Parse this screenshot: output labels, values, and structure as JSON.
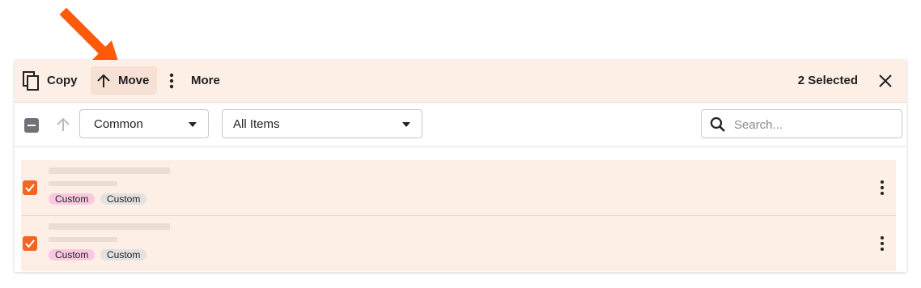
{
  "callout": {
    "icon": "orange-arrow-icon",
    "color": "#ff5a0a"
  },
  "action_bar": {
    "copy_label": "Copy",
    "move_label": "Move",
    "more_label": "More",
    "selected_text": "2 Selected",
    "icons": [
      "copy-icon",
      "arrow-up-icon",
      "more-vertical-icon",
      "close-icon"
    ]
  },
  "filters": {
    "category_select": "Common",
    "type_select": "All Items",
    "search_placeholder": "Search..."
  },
  "rows": [
    {
      "checked": true,
      "tags": [
        "Custom",
        "Custom"
      ]
    },
    {
      "checked": true,
      "tags": [
        "Custom",
        "Custom"
      ]
    }
  ],
  "colors": {
    "accent": "#f26522",
    "selection_bg": "#fdeee6",
    "tag_pink": "#f9c9e0",
    "tag_gray": "#e2e2e2"
  }
}
